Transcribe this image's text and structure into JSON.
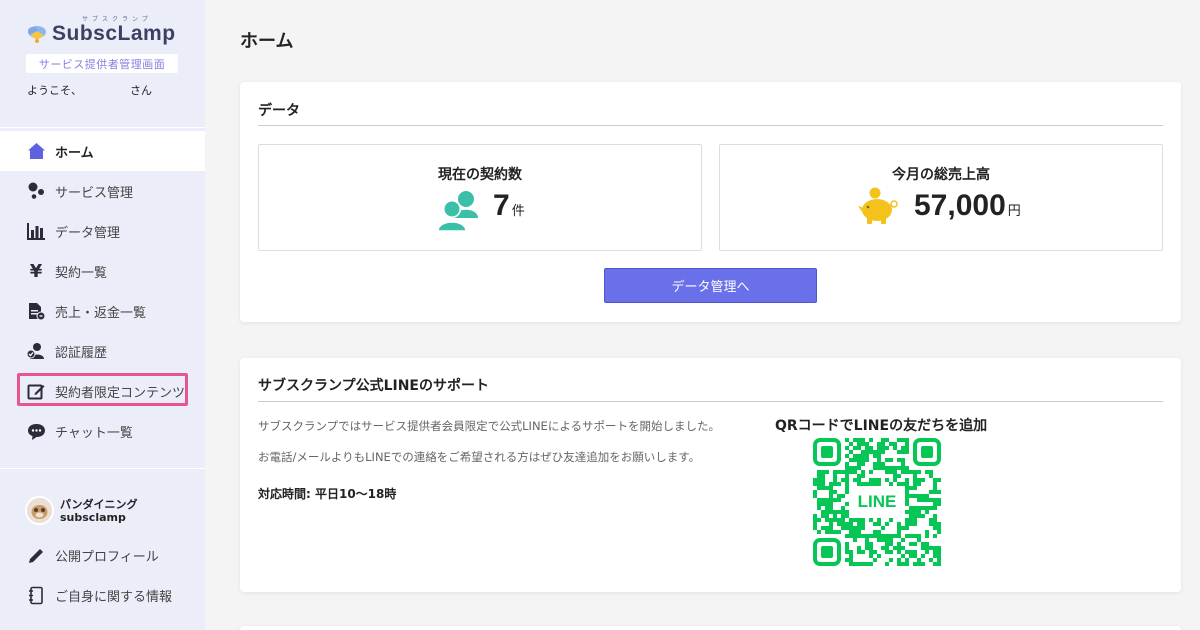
{
  "brand": {
    "logo_text": "SubscLamp",
    "logo_ruby": "サブスクランプ",
    "role_badge": "サービス提供者管理画面",
    "welcome_prefix": "ようこそ、",
    "welcome_suffix": "さん"
  },
  "sidebar": {
    "items": [
      {
        "label": "ホーム",
        "icon": "home-icon",
        "active": true
      },
      {
        "label": "サービス管理",
        "icon": "service-icon"
      },
      {
        "label": "データ管理",
        "icon": "bar-chart-icon"
      },
      {
        "label": "契約一覧",
        "icon": "yen-icon"
      },
      {
        "label": "売上・返金一覧",
        "icon": "document-refund-icon"
      },
      {
        "label": "認証履歴",
        "icon": "user-check-icon"
      },
      {
        "label": "契約者限定コンテンツ",
        "icon": "edit-icon",
        "highlighted": true
      },
      {
        "label": "チャット一覧",
        "icon": "chat-icon"
      }
    ],
    "profile": {
      "name": "パンダイニング",
      "handle": "subsclamp"
    },
    "items2": [
      {
        "label": "公開プロフィール",
        "icon": "pencil-icon"
      },
      {
        "label": "ご自身に関する情報",
        "icon": "notebook-icon"
      }
    ]
  },
  "main": {
    "title": "ホーム",
    "data_card": {
      "title": "データ",
      "contracts": {
        "label": "現在の契約数",
        "value": "7",
        "unit": "件"
      },
      "sales": {
        "label": "今月の総売上高",
        "value": "57,000",
        "unit": "円"
      },
      "button": "データ管理へ"
    },
    "line_card": {
      "title": "サブスクランプ公式LINEのサポート",
      "text1": "サブスクランプではサービス提供者会員限定で公式LINEによるサポートを開始しました。",
      "text2": "お電話/メールよりもLINEでの連絡をご希望される方はぜひ友達追加をお願いします。",
      "hours": "対応時間: 平日10〜18時",
      "qr_title": "QRコードでLINEの友だちを追加",
      "qr_label": "LINE"
    }
  },
  "colors": {
    "sidebar_bg": "#ebeef8",
    "accent": "#6a6fea",
    "highlight": "#e8568e",
    "teal": "#3cbfa9",
    "gold": "#f3c21b",
    "line_green": "#06c755"
  }
}
